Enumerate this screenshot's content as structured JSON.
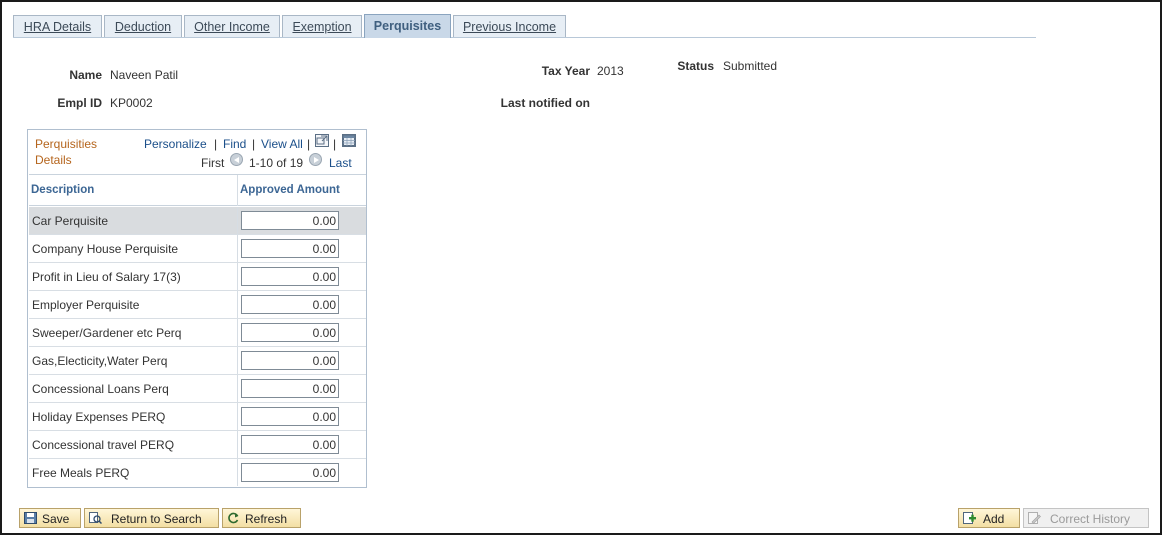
{
  "tabs": [
    {
      "label": "HRA Details",
      "active": false
    },
    {
      "label": "Deduction",
      "active": false
    },
    {
      "label": "Other Income",
      "active": false
    },
    {
      "label": "Exemption",
      "active": false
    },
    {
      "label": "Perquisites",
      "active": true
    },
    {
      "label": "Previous Income",
      "active": false
    }
  ],
  "header": {
    "name_label": "Name",
    "name_value": "Naveen Patil",
    "emplid_label": "Empl ID",
    "emplid_value": "KP0002",
    "taxyear_label": "Tax Year",
    "taxyear_value": "2013",
    "status_label": "Status",
    "status_value": "Submitted",
    "lastnotified_label": "Last notified on",
    "lastnotified_value": ""
  },
  "grid": {
    "title": "Perquisities Details",
    "personalize": "Personalize",
    "find": "Find",
    "view_all": "View All",
    "first": "First",
    "range": "1-10 of 19",
    "last": "Last",
    "columns": [
      "Description",
      "Approved Amount"
    ],
    "rows": [
      {
        "description": "Car Perquisite",
        "amount": "0.00"
      },
      {
        "description": "Company House Perquisite",
        "amount": "0.00"
      },
      {
        "description": "Profit in Lieu of Salary 17(3)",
        "amount": "0.00"
      },
      {
        "description": "Employer Perquisite",
        "amount": "0.00"
      },
      {
        "description": "Sweeper/Gardener etc Perq",
        "amount": "0.00"
      },
      {
        "description": "Gas,Electicity,Water Perq",
        "amount": "0.00"
      },
      {
        "description": "Concessional Loans Perq",
        "amount": "0.00"
      },
      {
        "description": "Holiday Expenses PERQ",
        "amount": "0.00"
      },
      {
        "description": "Concessional travel PERQ",
        "amount": "0.00"
      },
      {
        "description": "Free Meals PERQ",
        "amount": "0.00"
      }
    ]
  },
  "footer": {
    "save": "Save",
    "return_to_search": "Return to Search",
    "refresh": "Refresh",
    "add": "Add",
    "correct_history": "Correct History"
  },
  "colors": {
    "tab_active_bg": "#c9d8e8",
    "link": "#1b4f8a",
    "grid_title": "#b5651d",
    "button_bg": "#f3dfa4"
  }
}
